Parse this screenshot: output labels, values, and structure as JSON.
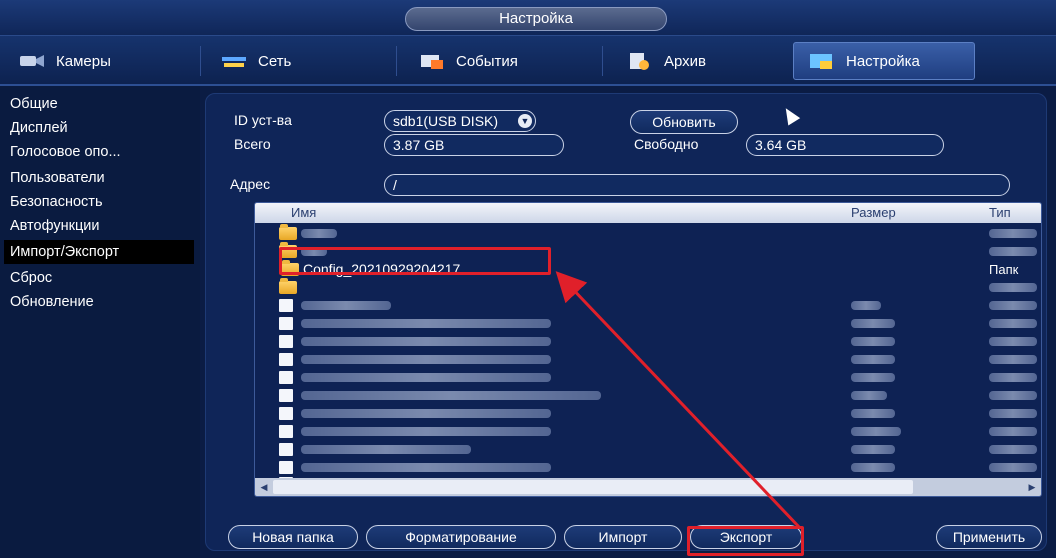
{
  "window": {
    "title": "Настройка"
  },
  "tabs": [
    {
      "label": "Камеры",
      "icon": "camera-icon"
    },
    {
      "label": "Сеть",
      "icon": "network-icon"
    },
    {
      "label": "События",
      "icon": "events-icon"
    },
    {
      "label": "Архив",
      "icon": "archive-icon"
    },
    {
      "label": "Настройка",
      "icon": "settings-icon",
      "active": true
    }
  ],
  "sidebar": {
    "items": [
      {
        "label": "Общие"
      },
      {
        "label": "Дисплей"
      },
      {
        "label": "Голосовое опо..."
      },
      {
        "label": "Пользователи"
      },
      {
        "label": "Безопасность"
      },
      {
        "label": "Автофункции"
      },
      {
        "label": "Импорт/Экспорт",
        "active": true
      },
      {
        "label": "Сброс"
      },
      {
        "label": "Обновление"
      }
    ]
  },
  "device": {
    "id_label": "ID уст-ва",
    "id_value": "sdb1(USB DISK)",
    "refresh_label": "Обновить",
    "total_label": "Всего",
    "total_value": "3.87 GB",
    "free_label": "Свободно",
    "free_value": "3.64 GB"
  },
  "address": {
    "label": "Адрес",
    "value": "/"
  },
  "filelist": {
    "columns": {
      "name": "Имя",
      "size": "Размер",
      "type": "Тип"
    },
    "highlighted_folder": "Config_20210929204217",
    "highlighted_type": "Папк"
  },
  "actions": {
    "new_folder": "Новая папка",
    "format": "Форматирование",
    "import": "Импорт",
    "export": "Экспорт",
    "apply": "Применить"
  },
  "colors": {
    "highlight": "#e0202a",
    "background": "#0b1c44"
  }
}
